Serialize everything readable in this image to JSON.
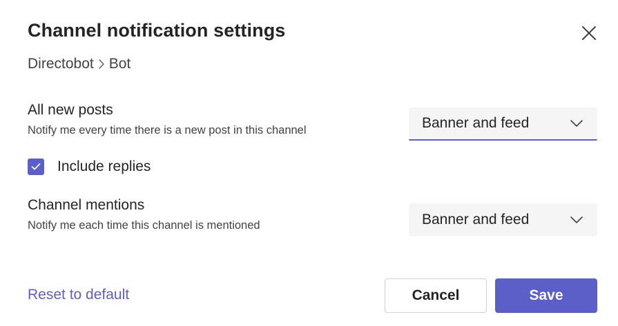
{
  "dialog": {
    "title": "Channel notification settings",
    "close_icon": "close-icon"
  },
  "breadcrumb": {
    "team": "Directobot",
    "separator_icon": "chevron-right-icon",
    "channel": "Bot"
  },
  "settings": {
    "all_new_posts": {
      "title": "All new posts",
      "description": "Notify me every time there is a new post in this channel",
      "selected_value": "Banner and feed"
    },
    "include_replies": {
      "label": "Include replies",
      "checked": true
    },
    "channel_mentions": {
      "title": "Channel mentions",
      "description": "Notify me each time this channel is mentioned",
      "selected_value": "Banner and feed"
    }
  },
  "footer": {
    "reset_label": "Reset to default",
    "cancel_label": "Cancel",
    "save_label": "Save"
  },
  "colors": {
    "accent": "#5b5fc7",
    "text_primary": "#242424",
    "text_secondary": "#424242",
    "dropdown_bg": "#f5f5f5",
    "border": "#d1d1d1"
  }
}
